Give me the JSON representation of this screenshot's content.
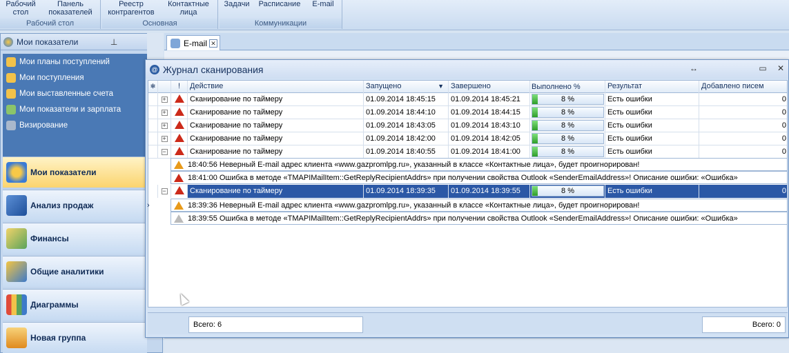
{
  "ribbon": {
    "groups": [
      {
        "label": "Рабочий стол",
        "buttons": [
          "Рабочий\nстол",
          "Панель\nпоказателей"
        ]
      },
      {
        "label": "Основная",
        "buttons": [
          "Реестр\nконтрагентов",
          "Контактные\nлица"
        ]
      },
      {
        "label": "Коммуникации",
        "buttons": [
          "Задачи",
          "Расписание",
          "E-mail"
        ]
      }
    ]
  },
  "left_panel": {
    "title": "Мои показатели",
    "pin_icon": "pin-icon",
    "close_label": "×",
    "nav_items": [
      {
        "label": "Мои планы поступлений",
        "icon": "folder-icon"
      },
      {
        "label": "Мои поступления",
        "icon": "folder-icon"
      },
      {
        "label": "Мои выставленные счета",
        "icon": "folder-icon"
      },
      {
        "label": "Мои показатели и зарплата",
        "icon": "people-icon"
      },
      {
        "label": "Визирование",
        "icon": "stamp-icon"
      }
    ],
    "groups": [
      {
        "label": "Мои показатели",
        "active": true
      },
      {
        "label": "Анализ продаж",
        "active": false
      },
      {
        "label": "Финансы",
        "active": false
      },
      {
        "label": "Общие аналитики",
        "active": false
      },
      {
        "label": "Диаграммы",
        "active": false
      },
      {
        "label": "Новая группа",
        "active": false
      }
    ]
  },
  "doc_tab": {
    "label": "E-mail"
  },
  "journal": {
    "title": "Журнал сканирования",
    "columns": [
      "Действие",
      "Запущено",
      "Завершено",
      "Выполнено %",
      "Результат",
      "Добавлено писем"
    ],
    "rows": [
      {
        "action": "Сканирование по таймеру",
        "started": "01.09.2014 18:45:15",
        "finished": "01.09.2014 18:45:21",
        "progress": 8,
        "progress_label": "8 %",
        "result": "Есть ошибки",
        "added": "0",
        "expand": "+"
      },
      {
        "action": "Сканирование по таймеру",
        "started": "01.09.2014 18:44:10",
        "finished": "01.09.2014 18:44:15",
        "progress": 8,
        "progress_label": "8 %",
        "result": "Есть ошибки",
        "added": "0",
        "expand": "+"
      },
      {
        "action": "Сканирование по таймеру",
        "started": "01.09.2014 18:43:05",
        "finished": "01.09.2014 18:43:10",
        "progress": 8,
        "progress_label": "8 %",
        "result": "Есть ошибки",
        "added": "0",
        "expand": "+"
      },
      {
        "action": "Сканирование по таймеру",
        "started": "01.09.2014 18:42:00",
        "finished": "01.09.2014 18:42:05",
        "progress": 8,
        "progress_label": "8 %",
        "result": "Есть ошибки",
        "added": "0",
        "expand": "+"
      },
      {
        "action": "Сканирование по таймеру",
        "started": "01.09.2014 18:40:55",
        "finished": "01.09.2014 18:41:00",
        "progress": 8,
        "progress_label": "8 %",
        "result": "Есть ошибки",
        "added": "0",
        "expand": "−"
      },
      {
        "action": "Сканирование по таймеру",
        "started": "01.09.2014 18:39:35",
        "finished": "01.09.2014 18:39:55",
        "progress": 8,
        "progress_label": "8 %",
        "result": "Есть ошибки",
        "added": "0",
        "expand": "−"
      }
    ],
    "messages_group1": [
      "18:40:56 Неверный E-mail адрес клиента «www.gazpromlpg.ru», указанный в классе «Контактные лица», будет проигнорирован!",
      "18:41:00 Ошибка в методе «TMAPIMailItem::GetReplyRecipientAddrs» при получении свойства Outlook «SenderEmailAddress»! Описание ошибки: «Ошибка»"
    ],
    "messages_group2": [
      "18:39:36 Неверный E-mail адрес клиента «www.gazpromlpg.ru», указанный в классе «Контактные лица», будет проигнорирован!",
      "18:39:55 Ошибка в методе «TMAPIMailItem::GetReplyRecipientAddrs» при получении свойства Outlook «SenderEmailAddress»! Описание ошибки: «Ошибка»"
    ],
    "footer_left": "Всего: 6",
    "footer_right": "Всего: 0"
  },
  "colors": {
    "selected_row": "#2b58a6",
    "error_icon": "#cc2a1a",
    "warning_icon": "#e89a1a",
    "progress_fill": "#2f9e2a"
  }
}
